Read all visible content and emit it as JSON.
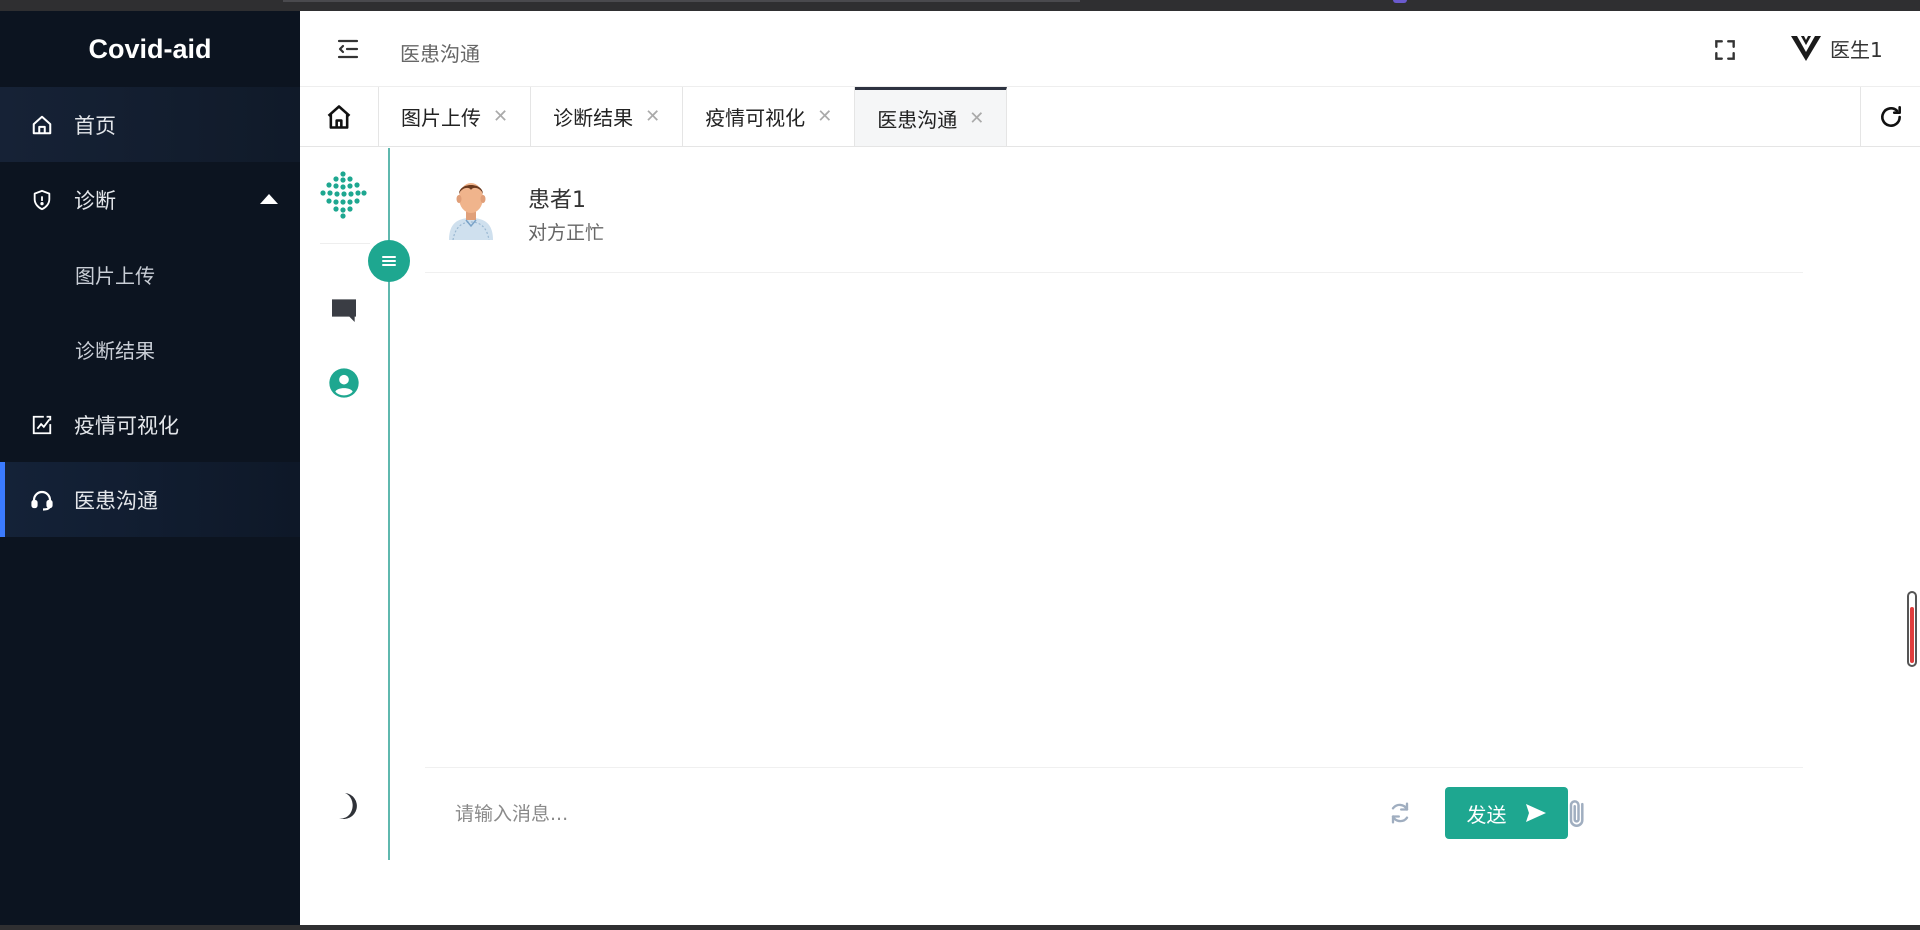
{
  "app": {
    "title": "Covid-aid"
  },
  "colors": {
    "sidebar_bg": "#0c1420",
    "accent": "#1ea790",
    "active_indicator": "#3b7bff"
  },
  "sidebar": {
    "items": [
      {
        "label": "首页",
        "icon": "home-icon"
      },
      {
        "label": "诊断",
        "icon": "shield-icon",
        "expanded": true,
        "children": [
          {
            "label": "图片上传"
          },
          {
            "label": "诊断结果"
          }
        ]
      },
      {
        "label": "疫情可视化",
        "icon": "chart-edit-icon"
      },
      {
        "label": "医患沟通",
        "icon": "headset-icon",
        "active": true
      }
    ]
  },
  "header": {
    "breadcrumb": "医患沟通",
    "user_name": "医生1"
  },
  "tabs": [
    {
      "label": "图片上传"
    },
    {
      "label": "诊断结果"
    },
    {
      "label": "疫情可视化"
    },
    {
      "label": "医患沟通",
      "active": true
    }
  ],
  "chat": {
    "contact": {
      "name": "患者1",
      "status": "对方正忙"
    },
    "composer": {
      "placeholder": "请输入消息...",
      "send_label": "发送"
    }
  }
}
